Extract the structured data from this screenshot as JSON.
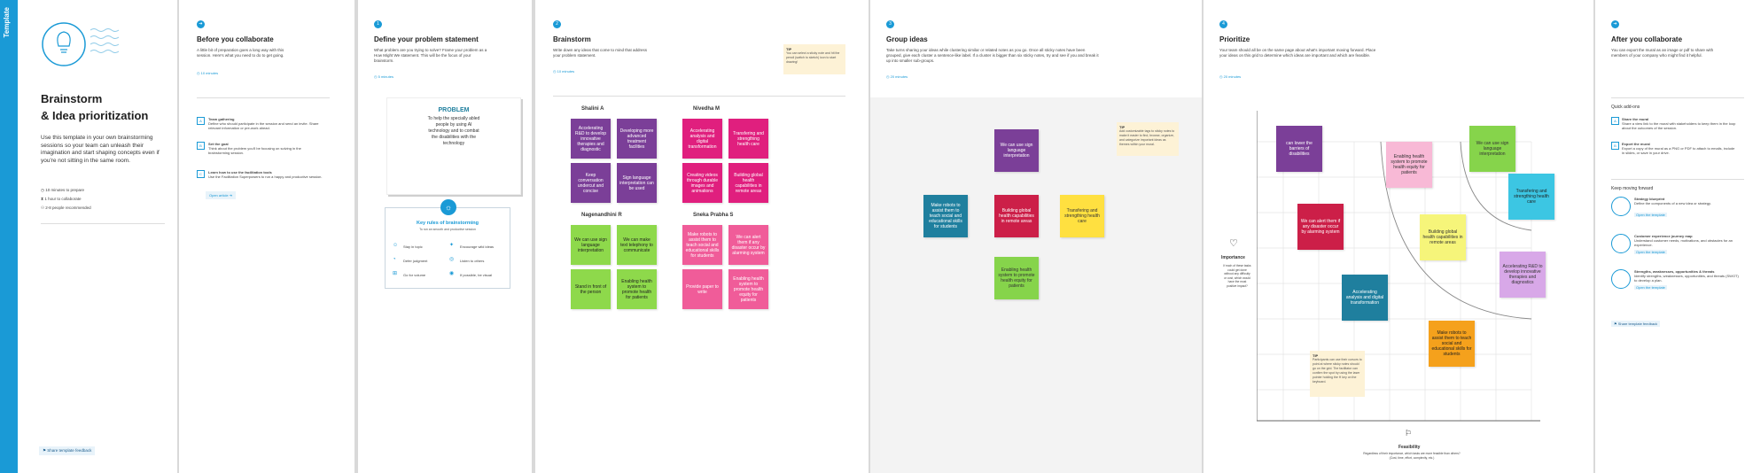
{
  "brand": {
    "label": "Template"
  },
  "intro": {
    "title_line1": "Brainstorm",
    "title_line2": "& Idea prioritization",
    "description": "Use this template in your own brainstorming sessions so your team can unleash their imagination and start shaping concepts even if you're not sitting in the same room.",
    "meta": [
      "10 minutes to prepare",
      "1 hour to collaborate",
      "2-8 people recommended"
    ],
    "feedback": "Share template feedback"
  },
  "before": {
    "title": "Before you collaborate",
    "desc": "A little bit of preparation goes a long way with this session. Here's what you need to do to get going.",
    "time": "10 minutes",
    "steps": [
      {
        "letter": "A",
        "title": "Team gathering",
        "text": "Define who should participate in the session and send an invite. Share relevant information or pre-work ahead."
      },
      {
        "letter": "B",
        "title": "Set the goal",
        "text": "Think about the problem you'll be focusing on solving in the brainstorming session."
      },
      {
        "letter": "C",
        "title": "Learn how to use the facilitation tools",
        "text": "Use the Facilitation Superpowers to run a happy and productive session."
      }
    ],
    "link": "Open article"
  },
  "define": {
    "number": "1",
    "title": "Define your problem statement",
    "desc": "What problem are you trying to solve? Frame your problem as a How Might We statement. This will be the focus of your brainstorm.",
    "time": "5 minutes",
    "problem_title": "PROBLEM",
    "problem_text": "To help the specially abled people by using AI technology and to combat the disabilities with the technology",
    "rules_title": "Key rules of brainstorming",
    "rules_sub": "To run an smooth and productive session",
    "rules": [
      "Stay in topic",
      "Encourage wild ideas",
      "Defer judgment",
      "Listen to others",
      "Go for volume",
      "If possible, be visual"
    ]
  },
  "brainstorm": {
    "number": "2",
    "title": "Brainstorm",
    "desc": "Write down any ideas that come to mind that address your problem statement.",
    "time": "10 minutes",
    "tip_title": "TIP",
    "tip_text": "You can select a sticky note and hit the pencil (switch to sketch) icon to start drawing!",
    "groups": [
      {
        "name": "Shalini A",
        "notes": [
          "Accelerating R&D to develop innovative therapies and diagnostic",
          "Developing more advanced treatment facilities",
          "Keep conversation undercut and concise",
          "Sign language interpretation can be used"
        ]
      },
      {
        "name": "Nivedha M",
        "notes": [
          "Accelerating analysis and digital transformation",
          "Transfering and strengthing health care",
          "Creating videos through durable images and animations",
          "Building global health capabilities in remote areas"
        ]
      },
      {
        "name": "Nagenandhini R",
        "notes": [
          "We can use sign language interpretation",
          "We can make text telephony to communicate",
          "Stand in front of the person",
          "Enabling health system to promote health for patients"
        ]
      },
      {
        "name": "Sneka Prabha S",
        "notes": [
          "Make robots to assist them to teach social and educational skills for students",
          "We can alert them if any disaster occur by alarming system",
          "Provide paper to write",
          "Enabling health system to promote health equity for patients"
        ]
      }
    ]
  },
  "group": {
    "number": "3",
    "title": "Group ideas",
    "desc": "Take turns sharing your ideas while clustering similar or related notes as you go. Once all sticky notes have been grouped, give each cluster a sentence-like label. If a cluster is bigger than six sticky notes, try and see if you and break it up into smaller sub-groups.",
    "time": "20 minutes",
    "tip_title": "TIP",
    "tip_text": "Add customizable tags to sticky notes to make it easier to find, browse, organize, and categorize important ideas as themes within your mural.",
    "notes": [
      "We can use sign language interpretation",
      "Make robots to assist them to teach social and educational skills for students",
      "Building global health capabilities in remote areas",
      "Transfering and strengthing health care",
      "Enabling health system to promote health equity for patients"
    ]
  },
  "prioritize": {
    "number": "4",
    "title": "Prioritize",
    "desc": "Your team should all be on the same page about what's important moving forward. Place your ideas on this grid to determine which ideas are important and which are feasible.",
    "time": "20 minutes",
    "importance_label": "Importance",
    "importance_text": "If each of these tasks could get done without any difficulty or cost, which would have the most positive impact?",
    "feasibility_label": "Feasibility",
    "feasibility_text": "Regardless of their importance, which tasks are more feasible than others? (Cost, time, effort, complexity, etc.)",
    "tip_title": "TIP",
    "tip_text": "Participants can use their cursors to point at where sticky notes should go on the grid. The facilitator can confirm the spot by using the laser pointer holding the H key on the keyboard.",
    "notes": [
      "can lower the barriers of disabilities",
      "Enabling health system to promote health equity for patients",
      "We can use sign language interpretation",
      "Transfering and strengthing health care",
      "We can alert them if any disaster occur by alarming system",
      "Building global health capabilities in remote areas",
      "Accelerating R&D to develop innovative therapies and diagnostics",
      "Accelerating analysis and digital transformation",
      "Make robots to assist them to teach social and educational skills for students"
    ]
  },
  "after": {
    "title": "After you collaborate",
    "desc": "You can export the mural as an image or pdf to share with members of your company who might find it helpful.",
    "quick_title": "Quick add-ons",
    "quick": [
      {
        "letter": "A",
        "title": "Share the mural",
        "text": "Share a view link to the mural with stakeholders to keep them in the loop about the outcomes of the session."
      },
      {
        "letter": "B",
        "title": "Export the mural",
        "text": "Export a copy of the mural as a PNG or PDF to attach to emails, include in slides, or save in your drive."
      }
    ],
    "forward_title": "Keep moving forward",
    "forward": [
      {
        "title": "Strategy blueprint",
        "text": "Define the components of a new idea or strategy.",
        "link": "Open the template"
      },
      {
        "title": "Customer experience journey map",
        "text": "Understand customer needs, motivations, and obstacles for an experience.",
        "link": "Open the template"
      },
      {
        "title": "Strengths, weaknesses, opportunities & threats",
        "text": "Identify strengths, weaknesses, opportunities, and threats (SWOT) to develop a plan.",
        "link": "Open the template"
      }
    ],
    "feedback": "Share template feedback"
  }
}
